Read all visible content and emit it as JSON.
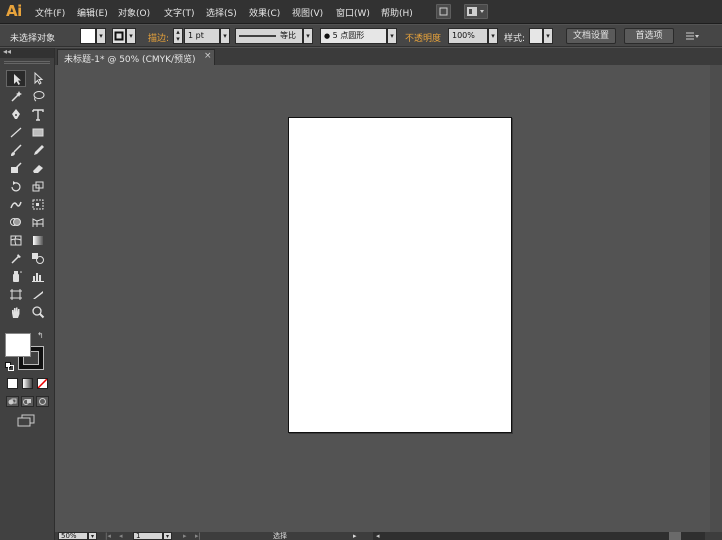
{
  "app": {
    "logo": "Ai"
  },
  "menu": {
    "items": [
      "文件(F)",
      "编辑(E)",
      "对象(O)",
      "文字(T)",
      "选择(S)",
      "效果(C)",
      "视图(V)",
      "窗口(W)",
      "帮助(H)"
    ]
  },
  "control_bar": {
    "selection_status": "未选择对象",
    "stroke_label": "描边:",
    "stroke_weight": "1 pt",
    "stroke_profile": "等比",
    "brush": "5 点圆形",
    "opacity_label": "不透明度",
    "opacity_value": "100%",
    "style_label": "样式:",
    "doc_setup_button": "文档设置",
    "preferences_button": "首选项"
  },
  "document": {
    "tab_title": "未标题-1* @ 50% (CMYK/预览)",
    "tab_close": "×"
  },
  "toolbox": {
    "collapse": "◂◂"
  },
  "status_bar": {
    "zoom": "50%",
    "page": "1",
    "status_text": "选择"
  },
  "colors": {
    "accent": "#e8a33b",
    "ui_dark": "#323232",
    "panel": "#464646",
    "canvas_bg": "#535353",
    "artboard": "#ffffff"
  }
}
